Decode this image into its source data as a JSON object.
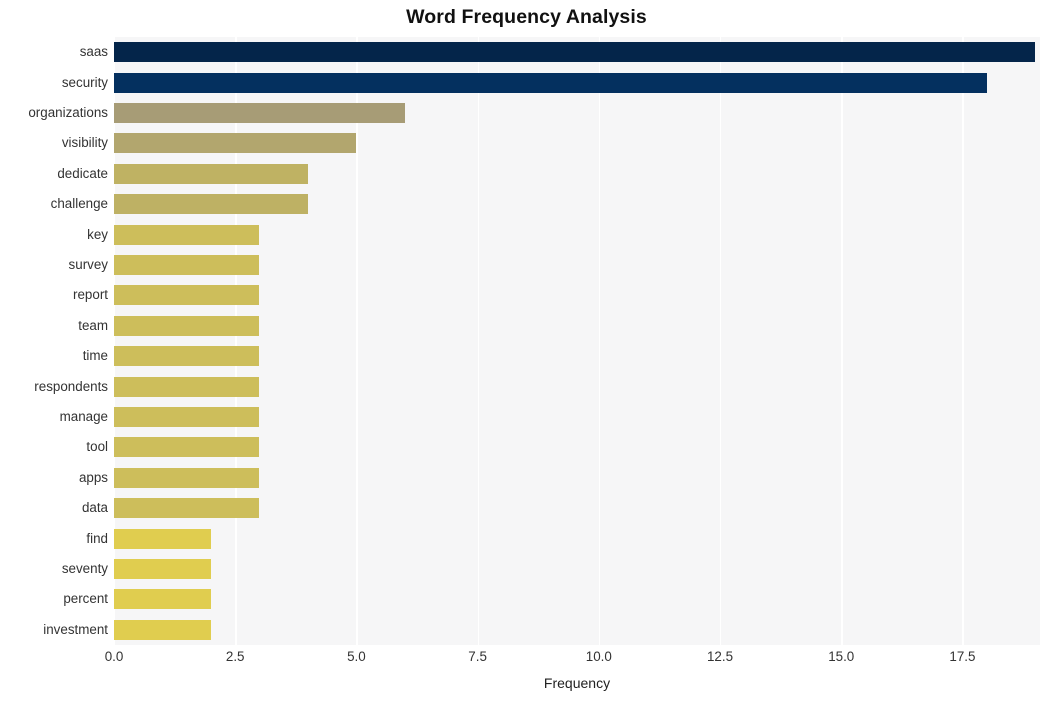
{
  "chart_data": {
    "type": "bar",
    "orientation": "horizontal",
    "title": "Word Frequency Analysis",
    "xlabel": "Frequency",
    "ylabel": "",
    "categories": [
      "saas",
      "security",
      "organizations",
      "visibility",
      "dedicate",
      "challenge",
      "key",
      "survey",
      "report",
      "team",
      "time",
      "respondents",
      "manage",
      "tool",
      "apps",
      "data",
      "find",
      "seventy",
      "percent",
      "investment"
    ],
    "values": [
      19,
      18,
      6,
      5,
      4,
      4,
      3,
      3,
      3,
      3,
      3,
      3,
      3,
      3,
      3,
      3,
      2,
      2,
      2,
      2
    ],
    "bar_colors": [
      "#04254a",
      "#04305f",
      "#a79c76",
      "#b2a66e",
      "#bfb263",
      "#beb164",
      "#cdbe5b",
      "#cdbe5b",
      "#cdbe5b",
      "#cdbe5b",
      "#cdbe5b",
      "#cdbe5b",
      "#cdbe5b",
      "#cdbe5b",
      "#cdbe5b",
      "#cdbe5b",
      "#e0cd4f",
      "#e0cd4f",
      "#e0cd4f",
      "#e0cd4f"
    ],
    "xlim": [
      0.0,
      19.1
    ],
    "xticks": [
      0.0,
      2.5,
      5.0,
      7.5,
      10.0,
      12.5,
      15.0,
      17.5
    ],
    "xtick_labels": [
      "0.0",
      "2.5",
      "5.0",
      "7.5",
      "10.0",
      "12.5",
      "15.0",
      "17.5"
    ],
    "grid": {
      "vertical": true,
      "horizontal": false,
      "color": "#ffffff"
    },
    "legend": null,
    "plot_background": "#f6f6f7",
    "figure_background": "#ffffff"
  }
}
